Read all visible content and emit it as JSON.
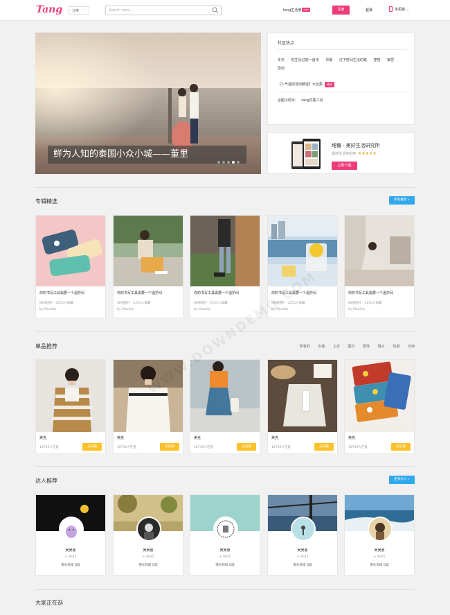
{
  "header": {
    "logo": "Tang",
    "category": "分类",
    "search_placeholder": "Search here...",
    "app_link": "tang生活家",
    "app_badge": "new",
    "register": "注册",
    "login": "登录",
    "mobile": "手机版"
  },
  "hero": {
    "caption": "鲜为人知的泰国小众小城——董里",
    "slides": 5,
    "active_slide": 4
  },
  "hot": {
    "title": "社区热点",
    "tags": [
      "冬天",
      "把生活过成一首诗",
      "早餐",
      "过下时间生活的路",
      "穿搭",
      "家居",
      "原创"
    ],
    "event_prefix": "【人气温情活动",
    "event_hi": "精选",
    "event_suffix": "】大合集",
    "event_badge": "精选",
    "tool_label": "合图小助手:",
    "tool_link": "tang优集工具"
  },
  "app": {
    "title": "堆糖 · 美好生活研究所",
    "subtitle": "最佳生活类应用",
    "stars": "★★★★★",
    "download": "立即下载"
  },
  "albums": {
    "title": "专辑精选",
    "more": "所有推荐 »",
    "items": [
      {
        "title": "你的书写工具需要一个温护间",
        "stats": "68张图片 · 2255人收藏",
        "author": "by Moodily"
      },
      {
        "title": "你的书写工具需要一个温护间",
        "stats": "68张图片 · 2255人收藏",
        "author": "by Moodily"
      },
      {
        "title": "你的书写工具需要一个温护间",
        "stats": "68张图片 · 2255人收藏",
        "author": "by Moodily"
      },
      {
        "title": "你的书写工具需要一个温护间",
        "stats": "68张图片 · 2255人收藏",
        "author": "by Moodily"
      },
      {
        "title": "你的书写工具需要一个温护间",
        "stats": "68张图片 · 2255人收藏",
        "author": "by Moodily"
      }
    ]
  },
  "products": {
    "title": "单品推荐",
    "filters": [
      "所有的",
      "女装",
      "上衣",
      "围巾",
      "配饰",
      "鞋子",
      "包袋",
      "日用"
    ],
    "items": [
      {
        "name": "美克",
        "sales": "18739人在逛",
        "btn": "去店铺"
      },
      {
        "name": "美克",
        "sales": "18739人在逛",
        "btn": "去店铺"
      },
      {
        "name": "美克",
        "sales": "18739人在逛",
        "btn": "去店铺"
      },
      {
        "name": "美克",
        "sales": "18739人在逛",
        "btn": "去店铺"
      },
      {
        "name": "美克",
        "sales": "18739人在逛",
        "btn": "去店铺"
      }
    ]
  },
  "people": {
    "title": "达人推荐",
    "more": "更多达人 »",
    "items": [
      {
        "name": "吴吴睿",
        "stat": "9645",
        "desc": "擅长领域 Q版"
      },
      {
        "name": "吴吴睿",
        "stat": "9645",
        "desc": "擅长领域 Q版"
      },
      {
        "name": "吴吴睿",
        "stat": "9645",
        "desc": "擅长领域 Q版"
      },
      {
        "name": "吴吴睿",
        "stat": "9645",
        "desc": "擅长领域 Q版"
      },
      {
        "name": "吴吴睿",
        "stat": "9645",
        "desc": "擅长领域 Q版"
      }
    ]
  },
  "watermark": "WWW.DOWNDEMO.COM",
  "bottom_title": "大家正在逛",
  "colors": {
    "brand": "#ee3b7a",
    "accent_blue": "#31a8ec",
    "store_yellow": "#ffc12a"
  }
}
